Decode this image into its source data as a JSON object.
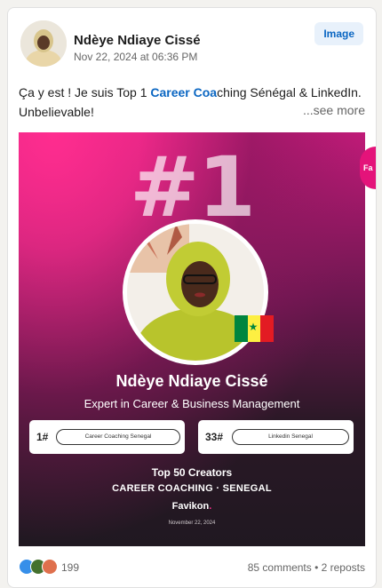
{
  "post": {
    "author": "Ndèye Ndiaye Cissé",
    "date": "Nov 22, 2024 at 06:36 PM",
    "badge": "Image",
    "text_before": "Ça y est ! Je suis Top 1 ",
    "text_highlight": "Career Coa",
    "text_after": "ching Sénégal & LinkedIn. Unbelievable!",
    "see_more": "...see more"
  },
  "promo": {
    "rank_big": "#1",
    "name": "Ndèye Ndiaye Cissé",
    "title": "Expert in Career & Business Management",
    "ranks": [
      {
        "num": "1#",
        "label": "Career Coaching Senegal"
      },
      {
        "num": "33#",
        "label": "Linkedin Senegal"
      }
    ],
    "top_creators": "Top 50 Creators",
    "category": "CAREER COACHING · SENEGAL",
    "brand": "Favikon",
    "date": "November 22, 2024",
    "flag_colors": [
      "#00853f",
      "#fdef42",
      "#e31b23"
    ]
  },
  "next_card": {
    "label": "Fa"
  },
  "footer": {
    "reaction_icons": [
      "like-icon",
      "celebrate-icon",
      "love-icon"
    ],
    "reactions_count": "199",
    "stats": "85 comments • 2 reposts"
  }
}
